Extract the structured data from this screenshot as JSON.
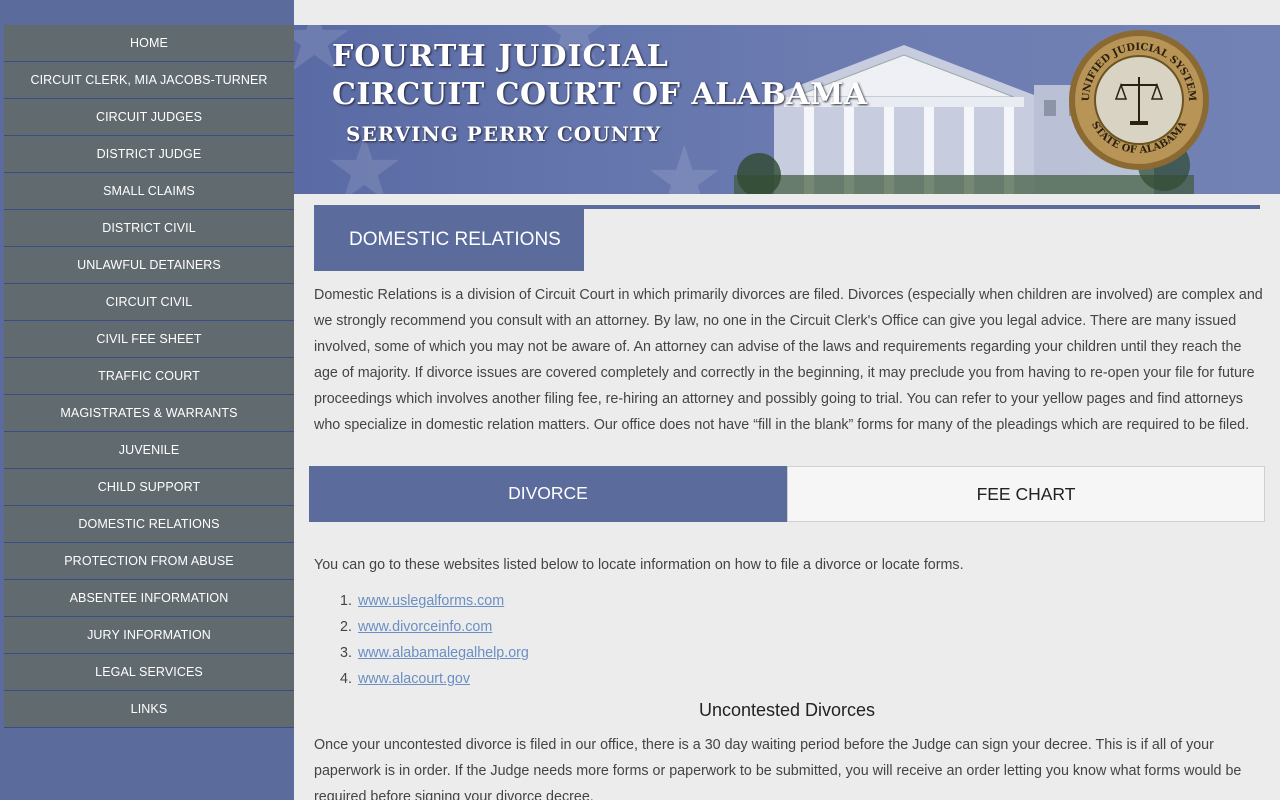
{
  "nav": {
    "items": [
      "HOME",
      "CIRCUIT CLERK, MIA JACOBS-TURNER",
      "CIRCUIT JUDGES",
      "DISTRICT JUDGE",
      "SMALL CLAIMS",
      "DISTRICT CIVIL",
      "UNLAWFUL DETAINERS",
      "CIRCUIT CIVIL",
      "CIVIL FEE SHEET",
      "TRAFFIC COURT",
      "MAGISTRATES & WARRANTS",
      "JUVENILE",
      "CHILD SUPPORT",
      "DOMESTIC RELATIONS",
      "PROTECTION FROM ABUSE",
      "ABSENTEE INFORMATION",
      "JURY INFORMATION",
      "LEGAL SERVICES",
      "LINKS"
    ]
  },
  "banner": {
    "line1": "FOURTH  JUDICIAL",
    "line2": "CIRCUIT COURT OF ALABAMA",
    "line3": "SERVING  PERRY  COUNTY",
    "seal": {
      "top_text": "UNIFIED JUDICIAL SYSTEM",
      "bottom_text": "STATE OF ALABAMA"
    }
  },
  "section": {
    "title": "DOMESTIC RELATIONS",
    "intro": "Domestic Relations is a division of Circuit Court in which primarily divorces are filed. Divorces (especially when children are involved) are complex and we strongly recommend you consult with an attorney. By law, no one in the Circuit Clerk's Office can give you legal advice. There are many issued involved, some of which you may not be aware of. An attorney can advise of the laws and requirements regarding your children until they reach the age of majority. If divorce issues are covered completely and correctly in the beginning, it may preclude you from having to re-open your file for future proceedings which involves another filing fee, re-hiring an attorney and possibly going to trial. You can refer to your yellow pages and find attorneys who specialize in domestic relation matters. Our office does not have “fill in the blank” forms for many of the pleadings which are required to be filed."
  },
  "tabs": {
    "divorce": "DIVORCE",
    "fee_chart": "FEE CHART"
  },
  "content": {
    "websites_intro": "You can go to these websites listed below to locate information on how to file a divorce or locate forms.",
    "links": [
      {
        "num": "1.",
        "text": "www.uslegalforms.com"
      },
      {
        "num": "2.",
        "text": "www.divorceinfo.com"
      },
      {
        "num": "3.",
        "text": "www.alabamalegalhelp.org"
      },
      {
        "num": "4.",
        "text": "www.alacourt.gov"
      }
    ],
    "uncontested_heading": "Uncontested Divorces",
    "uncontested_text": "Once your uncontested divorce is filed in our office, there is a 30 day waiting period before the Judge can sign your decree. This is if all of your paperwork is in order. If the Judge needs more forms or paperwork to be submitted, you will receive an order letting you know what forms would be required before signing your divorce decree."
  },
  "colors": {
    "sidebar_bg": "#5a6b9c",
    "nav_item_bg": "#616a6f",
    "accent": "#5a6b9c",
    "link": "#6a8fc3"
  }
}
